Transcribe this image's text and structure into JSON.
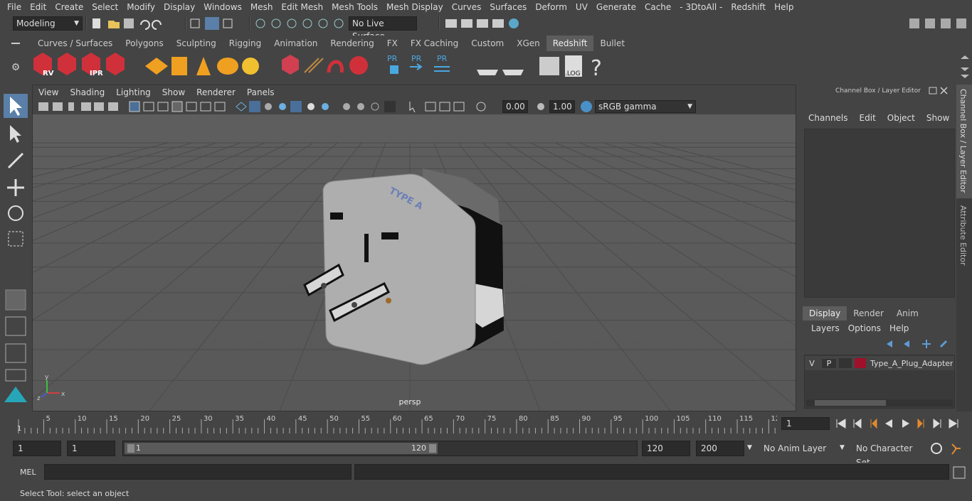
{
  "menubar": {
    "items": [
      "File",
      "Edit",
      "Create",
      "Select",
      "Modify",
      "Display",
      "Windows",
      "Mesh",
      "Edit Mesh",
      "Mesh Tools",
      "Mesh Display",
      "Curves",
      "Surfaces",
      "Deform",
      "UV",
      "Generate",
      "Cache",
      "- 3DtoAll -",
      "Redshift",
      "Help"
    ]
  },
  "statusline": {
    "mode": "Modeling",
    "live_surface": "No Live Surface"
  },
  "shelf": {
    "tabs": [
      "Curves / Surfaces",
      "Polygons",
      "Sculpting",
      "Rigging",
      "Animation",
      "Rendering",
      "FX",
      "FX Caching",
      "Custom",
      "XGen",
      "Redshift",
      "Bullet"
    ],
    "active_tab": "Redshift",
    "icon_labels": [
      "RV",
      "IPR",
      "PR",
      "PR",
      "PR",
      ".LOG",
      "?"
    ]
  },
  "viewport": {
    "menu": [
      "View",
      "Shading",
      "Lighting",
      "Show",
      "Renderer",
      "Panels"
    ],
    "exposure": "0.00",
    "gamma": "1.00",
    "color_space": "sRGB gamma",
    "camera_label": "persp",
    "model_text": "TYPE A",
    "axis": {
      "x": "x",
      "y": "y",
      "z": "z"
    }
  },
  "channelbox": {
    "title": "Channel Box / Layer Editor",
    "menu": [
      "Channels",
      "Edit",
      "Object",
      "Show"
    ]
  },
  "layers": {
    "tabs": [
      "Display",
      "Render",
      "Anim"
    ],
    "active_tab": "Display",
    "menu": [
      "Layers",
      "Options",
      "Help"
    ],
    "row": {
      "v": "V",
      "p": "P",
      "name": "Type_A_Plug_Adapter_",
      "color": "#a0102a"
    }
  },
  "side_tabs": [
    "Channel Box / Layer Editor",
    "Attribute Editor"
  ],
  "timeline": {
    "ticks": [
      "5",
      "10",
      "15",
      "20",
      "25",
      "30",
      "35",
      "40",
      "45",
      "50",
      "55",
      "60",
      "65",
      "70",
      "75",
      "80",
      "85",
      "90",
      "95",
      "100",
      "105",
      "110",
      "115",
      "12"
    ],
    "first_tick": "1",
    "current_frame": "1"
  },
  "range": {
    "start_a": "1",
    "start_b": "1",
    "slider_start": "1",
    "slider_end": "120",
    "end_a": "120",
    "end_b": "200",
    "anim_layer": "No Anim Layer",
    "char_set": "No Character Set"
  },
  "cmd": {
    "lang": "MEL"
  },
  "help": {
    "text": "Select Tool: select an object"
  },
  "colors": {
    "accent": "#5d9cd6",
    "bg": "#444444",
    "viewport": "#5a5a5a"
  }
}
